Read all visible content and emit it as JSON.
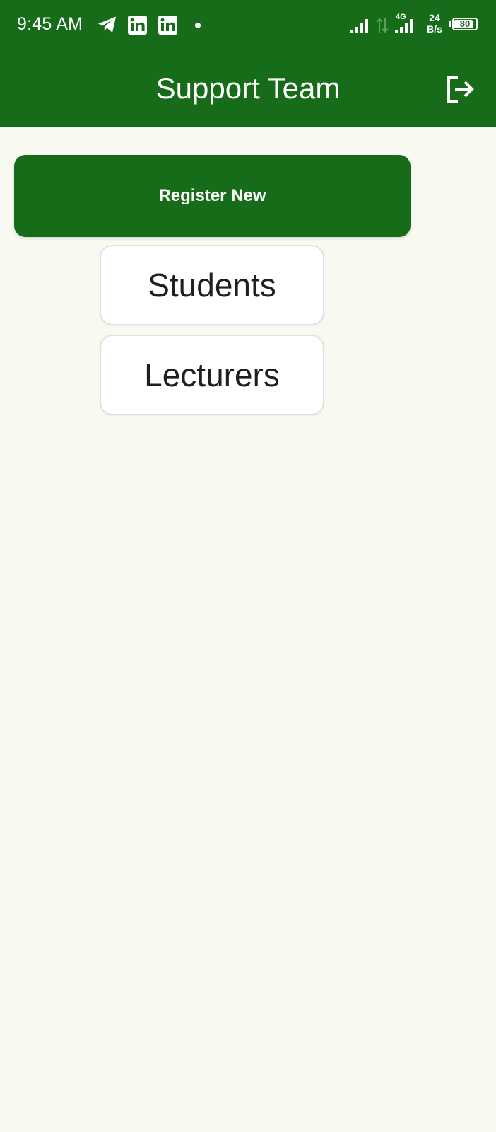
{
  "status_bar": {
    "time": "9:45 AM",
    "net_speed_value": "24",
    "net_speed_unit": "B/s",
    "network_type": "4G",
    "battery_level": "80",
    "icons": [
      "telegram-icon",
      "linkedin-icon",
      "linkedin-icon",
      "notification-dot",
      "signal-icon",
      "data-transfer-icon",
      "signal-4g-icon",
      "battery-icon"
    ]
  },
  "app_bar": {
    "title": "Support Team",
    "action_icon": "logout-icon"
  },
  "main": {
    "register_button_label": "Register New",
    "options": [
      {
        "label": "Students"
      },
      {
        "label": "Lecturers"
      }
    ]
  },
  "colors": {
    "primary": "#176c19",
    "background": "#f8faf2",
    "card": "#ffffff",
    "card_border": "#e0e0e0",
    "text_dark": "#1f1f1f"
  }
}
